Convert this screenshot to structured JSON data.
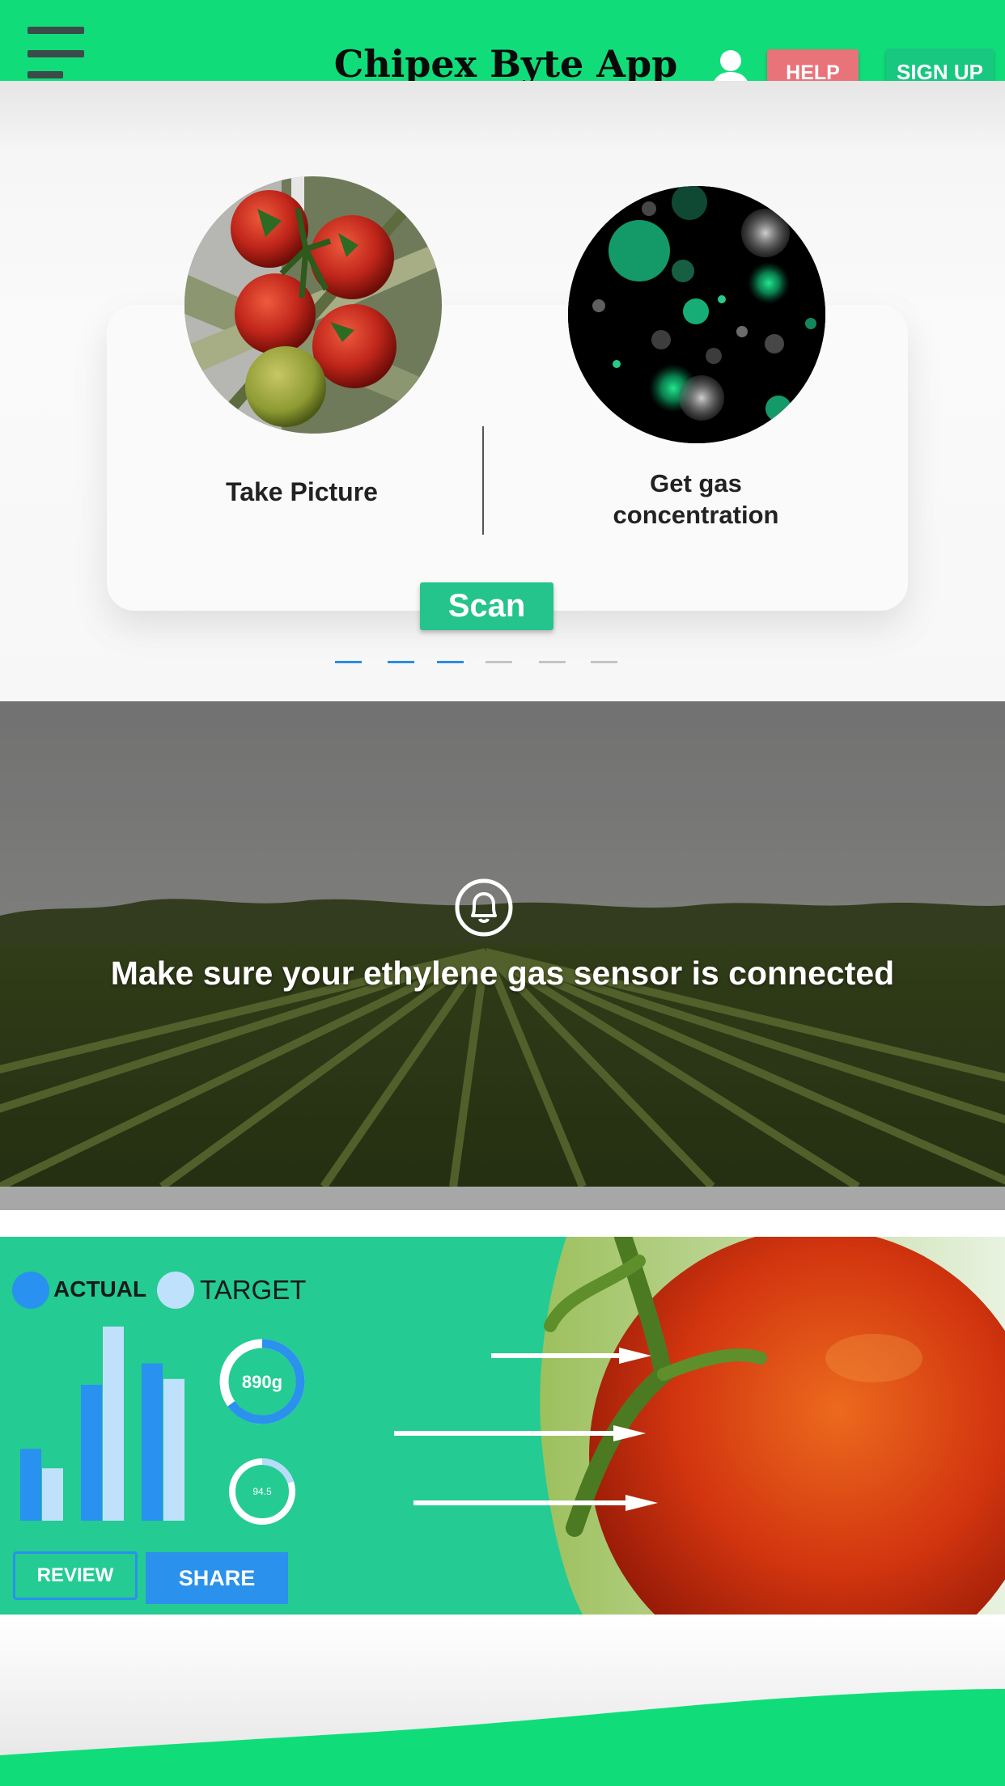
{
  "header": {
    "title": "Chipex Byte App",
    "help_label": "HELP",
    "signup_label": "SIGN UP",
    "menu_icon": "hamburger-menu-icon",
    "user_icon": "user-icon"
  },
  "carousel": {
    "slide": {
      "left_label": "Take Picture",
      "right_label": "Get gas concentration",
      "left_image": "tomato-vine-photo",
      "right_image": "gas-particles-photo"
    },
    "scan_label": "Scan",
    "dots_total": 6,
    "dots_active": 3
  },
  "banner": {
    "icon": "bell-icon",
    "message": "Make sure your ethylene gas sensor is connected"
  },
  "stats": {
    "legend_actual": "ACTUAL",
    "legend_target": "TARGET",
    "weight_value": "890g",
    "score_value": "94.5",
    "review_label": "REVIEW",
    "share_label": "SHARE",
    "image": "tomato-closeup-photo",
    "decor_icon": "arrow-right-icon"
  },
  "chart_data": {
    "type": "bar",
    "categories": [
      "",
      "",
      ""
    ],
    "series": [
      {
        "name": "ACTUAL",
        "values": [
          0.37,
          0.7,
          0.81
        ]
      },
      {
        "name": "TARGET",
        "values": [
          0.27,
          1.0,
          0.73
        ]
      }
    ],
    "rings": [
      {
        "label": "890g",
        "fraction": 0.65
      },
      {
        "label": "94.5",
        "fraction": 0.2
      }
    ]
  },
  "colors": {
    "brand_green": "#10dd7a",
    "panel_green": "#24cb93",
    "scan_green": "#24c48c",
    "help_red": "#e8747a",
    "actual_blue": "#2991ef",
    "target_blue": "#bfe1fb",
    "dot_active": "#2a8de6",
    "dot_inactive": "#c4c4c4"
  }
}
